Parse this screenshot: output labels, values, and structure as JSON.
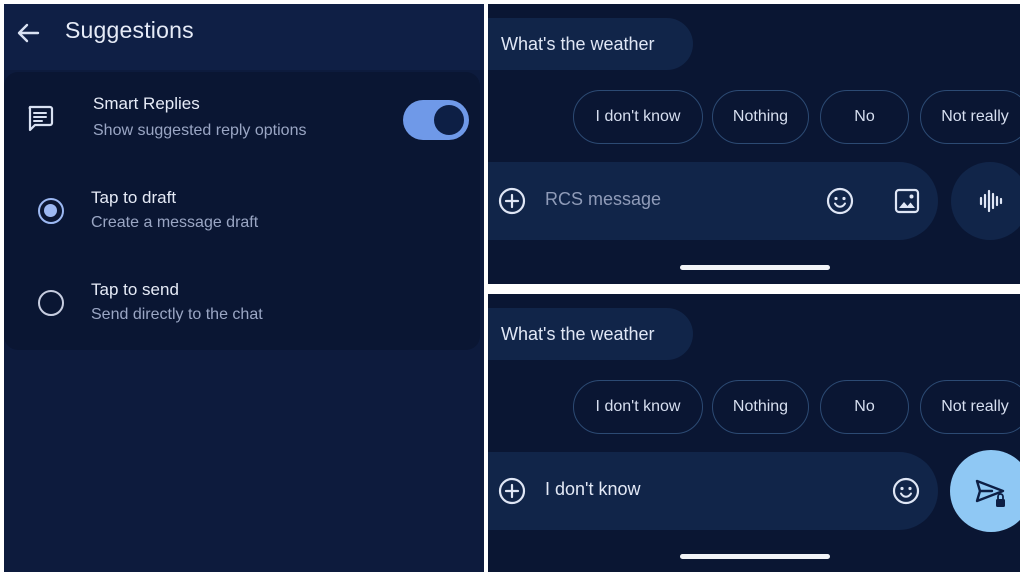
{
  "settings": {
    "title": "Suggestions",
    "smart_replies": {
      "title": "Smart Replies",
      "subtitle": "Show suggested reply options",
      "enabled": true
    },
    "options": [
      {
        "title": "Tap to draft",
        "subtitle": "Create a message draft",
        "selected": true
      },
      {
        "title": "Tap to send",
        "subtitle": "Send directly to the chat",
        "selected": false
      }
    ]
  },
  "chat_top": {
    "message": "What's the weather",
    "suggestions": [
      "I don't know",
      "Nothing",
      "No",
      "Not really"
    ],
    "compose_placeholder": "RCS message"
  },
  "chat_bottom": {
    "message": "What's the weather",
    "suggestions": [
      "I don't know",
      "Nothing",
      "No",
      "Not really"
    ],
    "compose_value": "I don't know"
  },
  "colors": {
    "background": "#0a1633",
    "surface": "#112549",
    "toggle_on": "#6f99e8",
    "radio_selected": "#9cb8f2",
    "send_button": "#8fc8f4"
  },
  "icons": {
    "back": "arrow-left-icon",
    "smart_replies": "message-icon",
    "add": "plus-circle-icon",
    "emoji": "emoji-icon",
    "image": "image-icon",
    "voice": "voice-waveform-icon",
    "send": "send-lock-icon"
  }
}
